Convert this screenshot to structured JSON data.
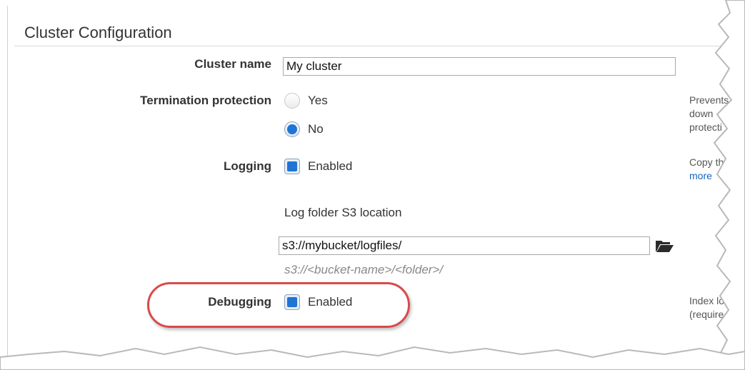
{
  "section": {
    "title": "Cluster Configuration"
  },
  "cluster_name": {
    "label": "Cluster name",
    "value": "My cluster"
  },
  "termination_protection": {
    "label": "Termination protection",
    "options": [
      {
        "label": "Yes",
        "checked": false
      },
      {
        "label": "No",
        "checked": true
      }
    ],
    "help": [
      "Prevents",
      "down",
      "protecti"
    ]
  },
  "logging": {
    "label": "Logging",
    "checkbox_label": "Enabled",
    "checked": true,
    "help": [
      "Copy th",
      "more"
    ],
    "s3_location_label": "Log folder S3 location",
    "s3_value": "s3://mybucket/logfiles/",
    "s3_hint": "s3://<bucket-name>/<folder>/",
    "folder_icon": "folder-open-icon"
  },
  "debugging": {
    "label": "Debugging",
    "checkbox_label": "Enabled",
    "checked": true,
    "help": [
      "Index lo",
      "(require"
    ]
  },
  "colors": {
    "accent": "#1f74d4",
    "highlight_outline": "#d94a4a",
    "link": "#1565c0"
  }
}
